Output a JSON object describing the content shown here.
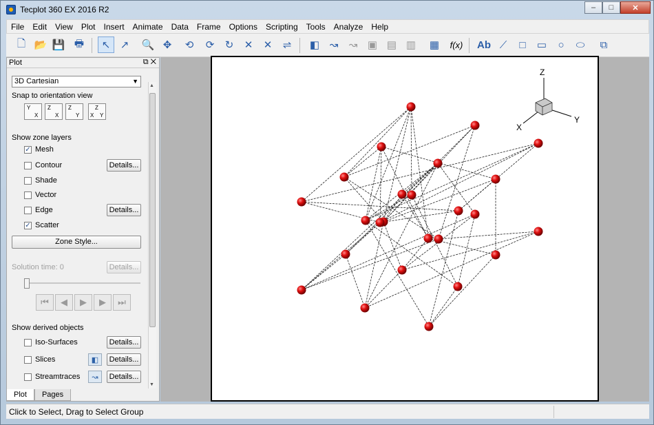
{
  "window": {
    "title": "Tecplot 360 EX 2016 R2",
    "close_label": "✕"
  },
  "menu": [
    "File",
    "Edit",
    "View",
    "Plot",
    "Insert",
    "Animate",
    "Data",
    "Frame",
    "Options",
    "Scripting",
    "Tools",
    "Analyze",
    "Help"
  ],
  "toolbar": {
    "text_tool_label": "Ab",
    "formula_label": "f(x)"
  },
  "panel": {
    "title": "Plot",
    "plot_type": "3D Cartesian",
    "snap_label": "Snap to orientation view",
    "zone_layers_label": "Show zone layers",
    "layers": [
      {
        "label": "Mesh",
        "checked": true,
        "details": false
      },
      {
        "label": "Contour",
        "checked": false,
        "details": true
      },
      {
        "label": "Shade",
        "checked": false,
        "details": false
      },
      {
        "label": "Vector",
        "checked": false,
        "details": false
      },
      {
        "label": "Edge",
        "checked": false,
        "details": true
      },
      {
        "label": "Scatter",
        "checked": true,
        "details": false
      }
    ],
    "details_label": "Details...",
    "zone_style_label": "Zone Style...",
    "solution_time_label": "Solution time: 0",
    "derived_label": "Show derived objects",
    "derived": [
      {
        "label": "Iso-Surfaces",
        "checked": false
      },
      {
        "label": "Slices",
        "checked": false
      },
      {
        "label": "Streamtraces",
        "checked": false
      }
    ],
    "check_mark": "✓"
  },
  "tabs": [
    "Plot",
    "Pages"
  ],
  "axes": {
    "x": "X",
    "y": "Y",
    "z": "Z"
  },
  "status": "Click to Select, Drag to Select Group"
}
